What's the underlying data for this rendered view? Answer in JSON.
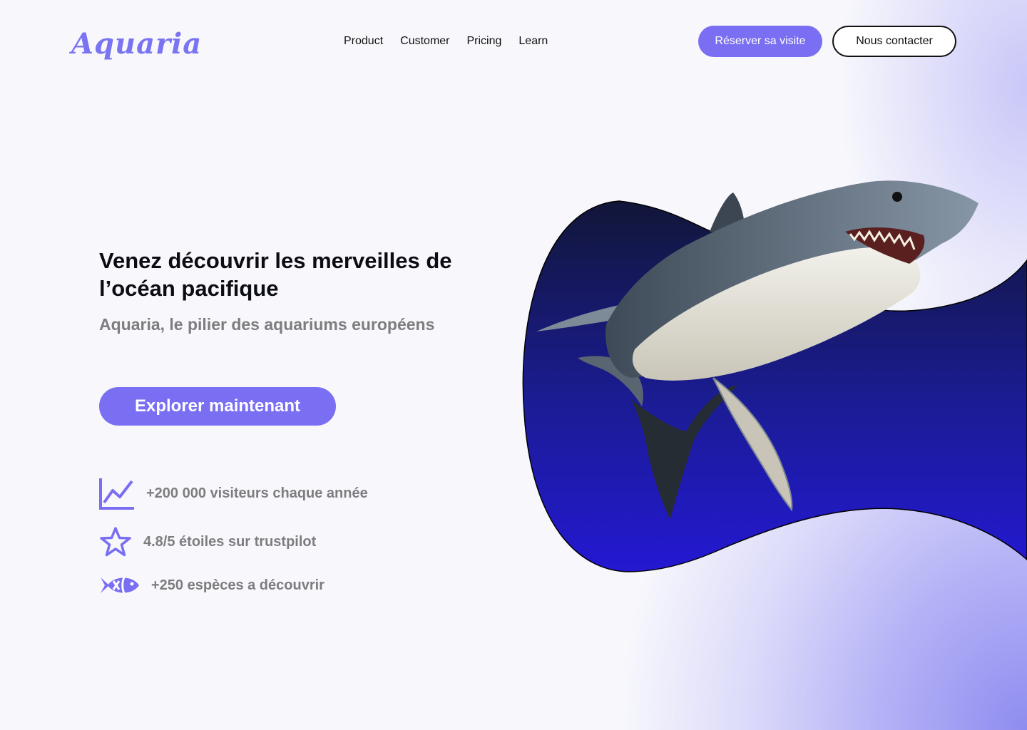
{
  "brand": {
    "name": "Aquaria",
    "color": "#7a74f2"
  },
  "nav": {
    "items": [
      {
        "label": "Product"
      },
      {
        "label": "Customer"
      },
      {
        "label": "Pricing"
      },
      {
        "label": "Learn"
      }
    ]
  },
  "header": {
    "book_label": "Réserver sa visite",
    "contact_label": "Nous contacter"
  },
  "hero": {
    "title": "Venez découvrir les merveilles de l’océan pacifique",
    "subtitle": "Aquaria, le pilier des aquariums européens",
    "cta_label": "Explorer maintenant"
  },
  "stats": [
    {
      "icon": "chart-line-icon",
      "label": "+200 000 visiteurs chaque année"
    },
    {
      "icon": "star-icon",
      "label": "4.8/5 étoiles sur trustpilot"
    },
    {
      "icon": "fish-icon",
      "label": "+250 espèces a découvrir"
    }
  ],
  "colors": {
    "accent": "#7a6ef2",
    "blob_top": "#111638",
    "blob_bottom": "#2418d2",
    "muted_text": "#7d7d80"
  }
}
